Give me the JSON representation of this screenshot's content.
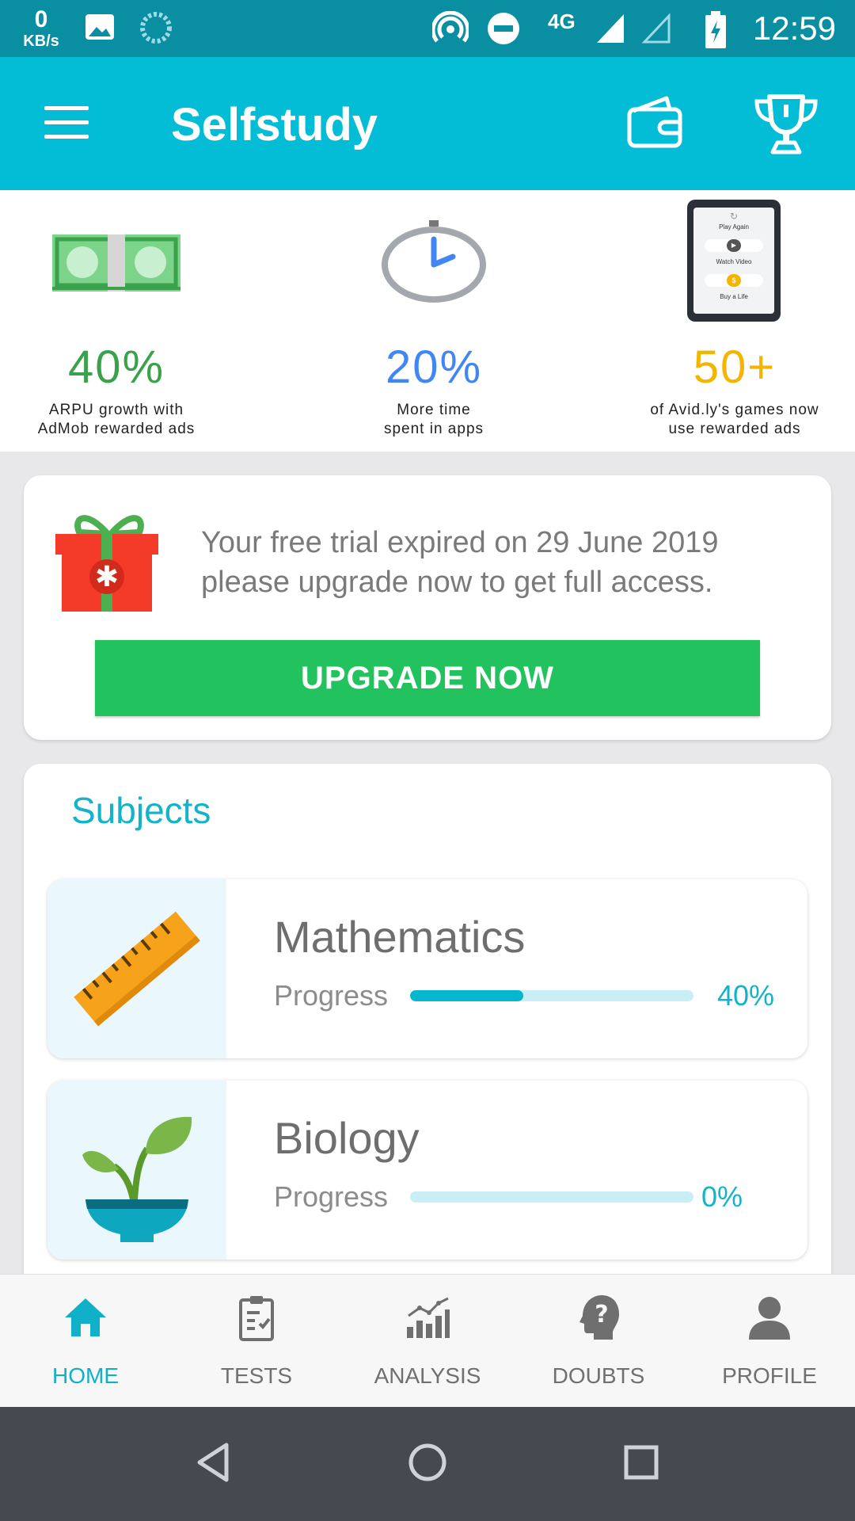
{
  "status_bar": {
    "speed_value": "0",
    "speed_unit": "KB/s",
    "network": "4G",
    "time": "12:59"
  },
  "app_bar": {
    "title": "Selfstudy"
  },
  "banner": {
    "stats": [
      {
        "value": "40%",
        "caption_line1": "ARPU growth with",
        "caption_line2": "AdMob rewarded ads",
        "color": "#3aa24b"
      },
      {
        "value": "20%",
        "caption_line1": "More time",
        "caption_line2": "spent in apps",
        "color": "#4285f4"
      },
      {
        "value": "50+",
        "caption_line1": "of Avid.ly's games now",
        "caption_line2": "use rewarded ads",
        "color": "#f4b400"
      }
    ],
    "phone_texts": {
      "play_again": "Play Again",
      "watch_video": "Watch Video",
      "buy_life": "Buy a Life"
    }
  },
  "trial": {
    "line1": "Your free trial expired on 29 June 2019",
    "line2": "please upgrade now to get full access.",
    "button_label": "UPGRADE NOW"
  },
  "subjects": {
    "heading": "Subjects",
    "items": [
      {
        "name": "Mathematics",
        "progress_label": "Progress",
        "progress_text": "40%",
        "progress": 0.4
      },
      {
        "name": "Biology",
        "progress_label": "Progress",
        "progress_text": "0%",
        "progress": 0.0
      }
    ]
  },
  "bottom_nav": {
    "items": [
      {
        "label": "HOME",
        "icon": "home-icon",
        "active": true
      },
      {
        "label": "TESTS",
        "icon": "clipboard-icon",
        "active": false
      },
      {
        "label": "ANALYSIS",
        "icon": "analysis-icon",
        "active": false
      },
      {
        "label": "DOUBTS",
        "icon": "doubts-icon",
        "active": false
      },
      {
        "label": "PROFILE",
        "icon": "profile-icon",
        "active": false
      }
    ]
  },
  "colors": {
    "primary": "#03bcd6",
    "status_bar": "#0a8ea1",
    "accent_green": "#22c35e",
    "progress_fill": "#06b6cf",
    "progress_track": "#c9eef6"
  }
}
